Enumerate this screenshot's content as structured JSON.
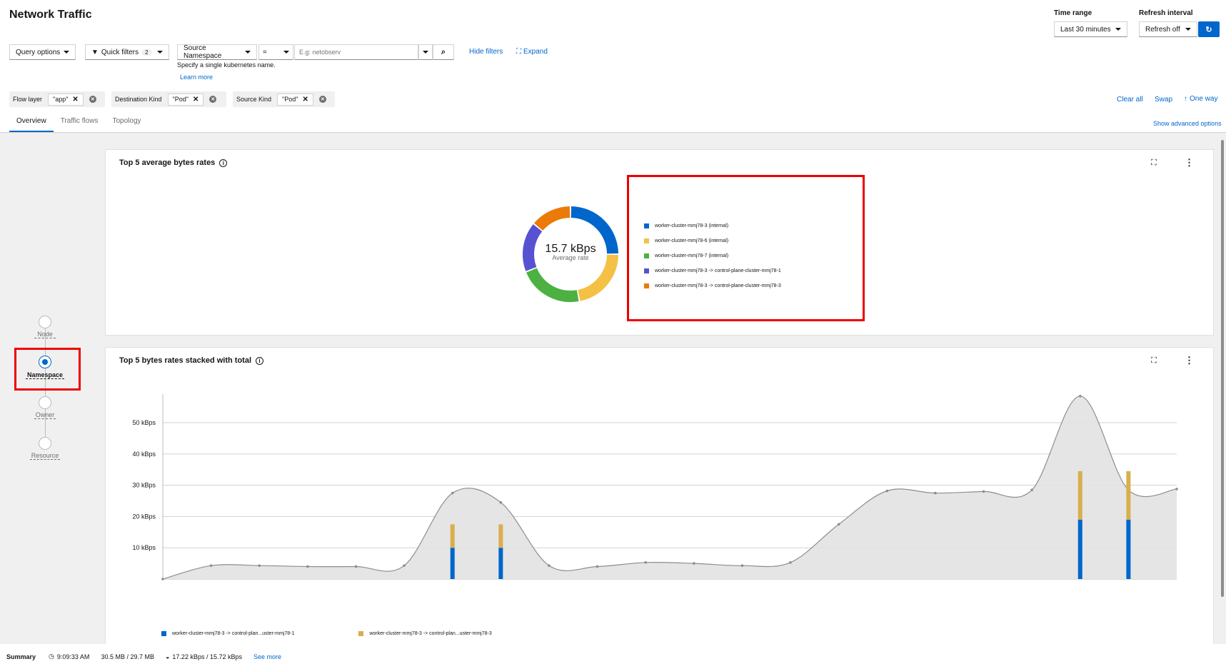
{
  "header": {
    "title": "Network Traffic",
    "time_range_label": "Time range",
    "time_range_value": "Last 30 minutes",
    "refresh_label": "Refresh interval",
    "refresh_value": "Refresh off"
  },
  "filters": {
    "query_options": "Query options",
    "quick_filters": "Quick filters",
    "quick_filters_count": "2",
    "source_field": "Source Namespace",
    "operator": "=",
    "input_placeholder": "E.g: netobserv",
    "helper": "Specify a single kubernetes name.",
    "learn_more": "Learn more",
    "hide_filters": "Hide filters",
    "expand": "Expand",
    "chips": [
      {
        "label": "Flow layer",
        "value": "\"app\""
      },
      {
        "label": "Destination Kind",
        "value": "\"Pod\""
      },
      {
        "label": "Source Kind",
        "value": "\"Pod\""
      }
    ],
    "clear_all": "Clear all",
    "swap": "Swap",
    "one_way": "One way"
  },
  "tabs": [
    "Overview",
    "Traffic flows",
    "Topology"
  ],
  "show_advanced": "Show advanced options",
  "scopes": [
    "Node",
    "Namespace",
    "Owner",
    "Resource"
  ],
  "selected_scope": "Namespace",
  "panel_donut": {
    "title": "Top 5 average bytes rates",
    "center_value": "15.7 kBps",
    "center_label": "Average rate"
  },
  "panel_bars": {
    "title": "Top 5 bytes rates stacked with total",
    "legend": [
      "worker-cluster-mmj78-3 -> control-plan...uster-mmj78-1",
      "worker-cluster-mmj78-3 -> control-plan...uster-mmj78-3"
    ]
  },
  "chart_data": [
    {
      "type": "pie",
      "title": "Top 5 average bytes rates",
      "labels": [
        "worker-cluster-mmj78-3 (internal)",
        "worker-cluster-mmj78-6 (internal)",
        "worker-cluster-mmj78-7 (internal)",
        "worker-cluster-mmj78-3 -> control-plane-cluster-mmj78-1",
        "worker-cluster-mmj78-3 -> control-plane-cluster-mmj78-3"
      ],
      "values": [
        25,
        22,
        22,
        17,
        14
      ],
      "colors": [
        "#0066cc",
        "#f4c145",
        "#4cb140",
        "#5752d1",
        "#ec7a08"
      ]
    },
    {
      "type": "area",
      "title": "Top 5 bytes rates stacked with total",
      "ylabel": "",
      "yticks": [
        "10 kBps",
        "20 kBps",
        "30 kBps",
        "40 kBps",
        "50 kBps"
      ],
      "ylim": [
        0,
        58
      ],
      "total": [
        0,
        4.3,
        4.3,
        4.0,
        4.0,
        4.3,
        27.5,
        24.5,
        4.3,
        4.0,
        5.3,
        5.0,
        4.3,
        5.3,
        17.5,
        28.2,
        27.5,
        28.0,
        28.5,
        58.5,
        28.5,
        28.8
      ],
      "bars": [
        {
          "index": 6,
          "blue": 10.0,
          "yellow": 7.5
        },
        {
          "index": 7,
          "blue": 10.0,
          "yellow": 7.5
        },
        {
          "index": 19,
          "blue": 19.0,
          "yellow": 15.5
        },
        {
          "index": 20,
          "blue": 19.0,
          "yellow": 15.5
        }
      ],
      "colors": {
        "blue": "#0066cc",
        "yellow": "#d8ae4f",
        "total_fill": "#e2e2e2",
        "total_line": "#8a8d90"
      }
    }
  ],
  "summary": {
    "label": "Summary",
    "time": "9:09:33 AM",
    "mem": "30.5 MB / 29.7 MB",
    "rate": "17.22 kBps / 15.72 kBps",
    "see_more": "See more"
  }
}
